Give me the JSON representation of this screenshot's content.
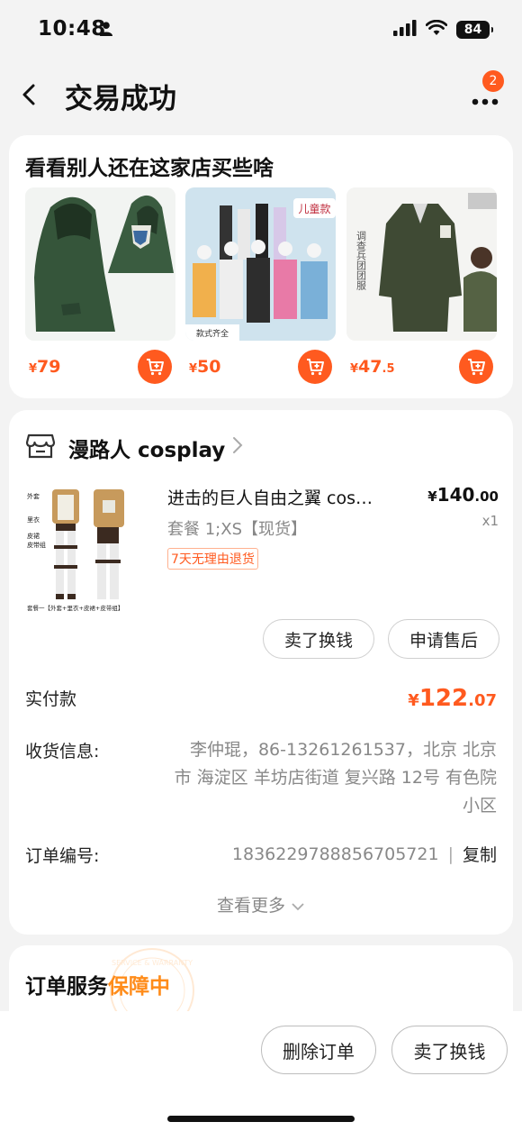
{
  "status_bar": {
    "time": "10:48",
    "battery": "84"
  },
  "nav": {
    "title": "交易成功",
    "badge_count": "2"
  },
  "recommend": {
    "title": "看看别人还在这家店买些啥",
    "items": [
      {
        "yen": "¥",
        "price": "79",
        "decimal": "",
        "image": "green-cloak"
      },
      {
        "yen": "¥",
        "price": "50",
        "decimal": "",
        "image": "kids-costumes",
        "image_label": "儿童款",
        "image_caption": "款式齐全"
      },
      {
        "yen": "¥",
        "price": "47",
        "decimal": ".5",
        "image": "military-coat",
        "image_label": "调查兵团团服"
      }
    ]
  },
  "order": {
    "shop_name": "漫路人 cosplay",
    "item": {
      "title": "进击的巨人自由之翼 cos…",
      "price_yen": "¥",
      "price_int": "140",
      "price_dec": ".00",
      "spec": "套餐 1;XS【现货】",
      "qty": "x1",
      "tag": "7天无理由退货",
      "image_caption": "套餐一【外套+里衣+皮裙+皮带组】",
      "image_labels": [
        "外套",
        "里衣",
        "皮裙",
        "皮带组"
      ]
    },
    "btn_sell": "卖了换钱",
    "btn_after_sale": "申请售后",
    "paid_label": "实付款",
    "paid_yen": "¥",
    "paid_int": "122",
    "paid_dec": ".07",
    "shipping_label": "收货信息:",
    "shipping_value": "李仲琨，86-13261261537，北京 北京市 海淀区 羊坊店街道 复兴路 12号 有色院小区",
    "order_no_label": "订单编号:",
    "order_no": "1836229788856705721",
    "order_no_sep": "|",
    "copy": "复制",
    "see_more": "查看更多"
  },
  "service": {
    "title_prefix": "订单服务",
    "title_highlight": "保障中",
    "seal_text": "SERVICE & WARRANTY"
  },
  "bottom": {
    "delete": "删除订单",
    "sell": "卖了换钱"
  },
  "colors": {
    "accent": "#ff5a1f",
    "service_orange": "#ff8c1a"
  }
}
